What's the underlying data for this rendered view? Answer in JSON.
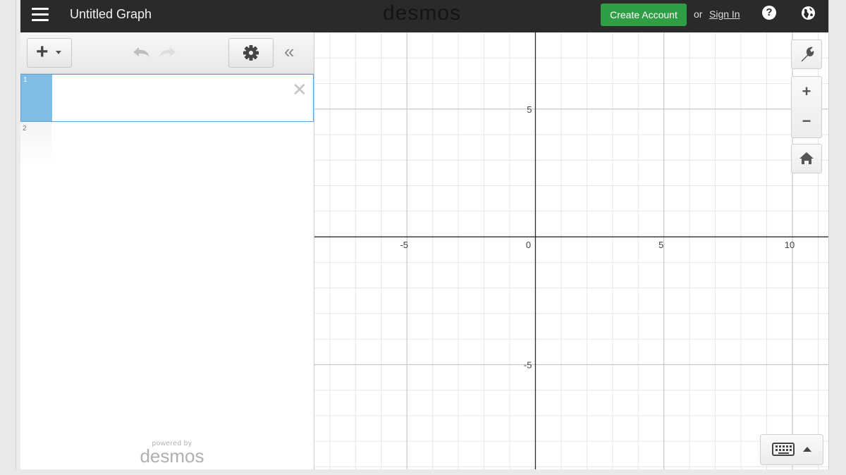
{
  "header": {
    "graph_title": "Untitled Graph",
    "brand": "desmos",
    "create_account_label": "Create Account",
    "or_label": "or",
    "sign_in_label": "Sign In",
    "help_label": "?",
    "icons": {
      "menu": "menu-icon",
      "help": "help-icon",
      "language": "globe-icon"
    }
  },
  "expression_panel": {
    "toolbar": {
      "add_label": "+",
      "icons": [
        "add-icon",
        "undo-icon",
        "redo-icon",
        "gear-icon",
        "collapse-icon"
      ]
    },
    "expressions": [
      {
        "number": "1",
        "value": "",
        "active": true
      },
      {
        "number": "2",
        "value": "",
        "active": false
      }
    ],
    "footer": {
      "powered_by": "powered by",
      "brand": "desmos"
    }
  },
  "graph": {
    "x_ticks": [
      "-5",
      "0",
      "5",
      "10"
    ],
    "y_ticks": [
      "5",
      "-5"
    ],
    "x_range": [
      -8.6,
      11.4
    ],
    "y_range": [
      -9.1,
      8.0
    ],
    "grid": true,
    "minor_grid_step": 1,
    "major_grid_step": 5,
    "controls": [
      "wrench-icon",
      "zoom-in-icon",
      "zoom-out-icon",
      "home-icon",
      "keyboard-icon"
    ],
    "zoom_in_label": "+",
    "zoom_out_label": "−"
  },
  "colors": {
    "topbar": "#2a2a2a",
    "create_account": "#2f9e44",
    "active_expression": "#7fbde5",
    "grid_minor": "#e6e6e6",
    "grid_major": "#bdbdbd",
    "axis": "#2b2b2b"
  }
}
